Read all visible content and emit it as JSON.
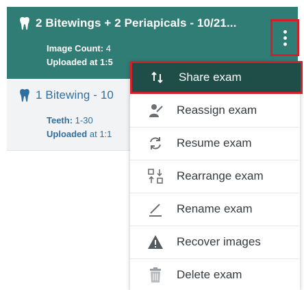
{
  "exams": [
    {
      "title": "2 Bitewings + 2 Periapicals - 10/21...",
      "meta1_key": "Image Count:",
      "meta1_val": "4",
      "meta2_key": "Uploaded at",
      "meta2_val": "1:5"
    },
    {
      "title": "1 Bitewing - 10",
      "meta1_key": "Teeth:",
      "meta1_val": "1-30",
      "meta2_key": "Uploaded",
      "meta2_val": "at 1:1"
    }
  ],
  "menu": {
    "items": [
      {
        "label": "Share exam",
        "icon": "share-icon"
      },
      {
        "label": "Reassign exam",
        "icon": "reassign-icon"
      },
      {
        "label": "Resume exam",
        "icon": "resume-icon"
      },
      {
        "label": "Rearrange exam",
        "icon": "rearrange-icon"
      },
      {
        "label": "Rename exam",
        "icon": "rename-icon"
      },
      {
        "label": "Recover images",
        "icon": "warning-icon"
      },
      {
        "label": "Delete exam",
        "icon": "trash-icon"
      }
    ]
  },
  "colors": {
    "selected_card": "#2f7d74",
    "active_menu": "#1f4e49",
    "highlight_border": "#d21f2b",
    "link_blue": "#2e6fa0"
  }
}
